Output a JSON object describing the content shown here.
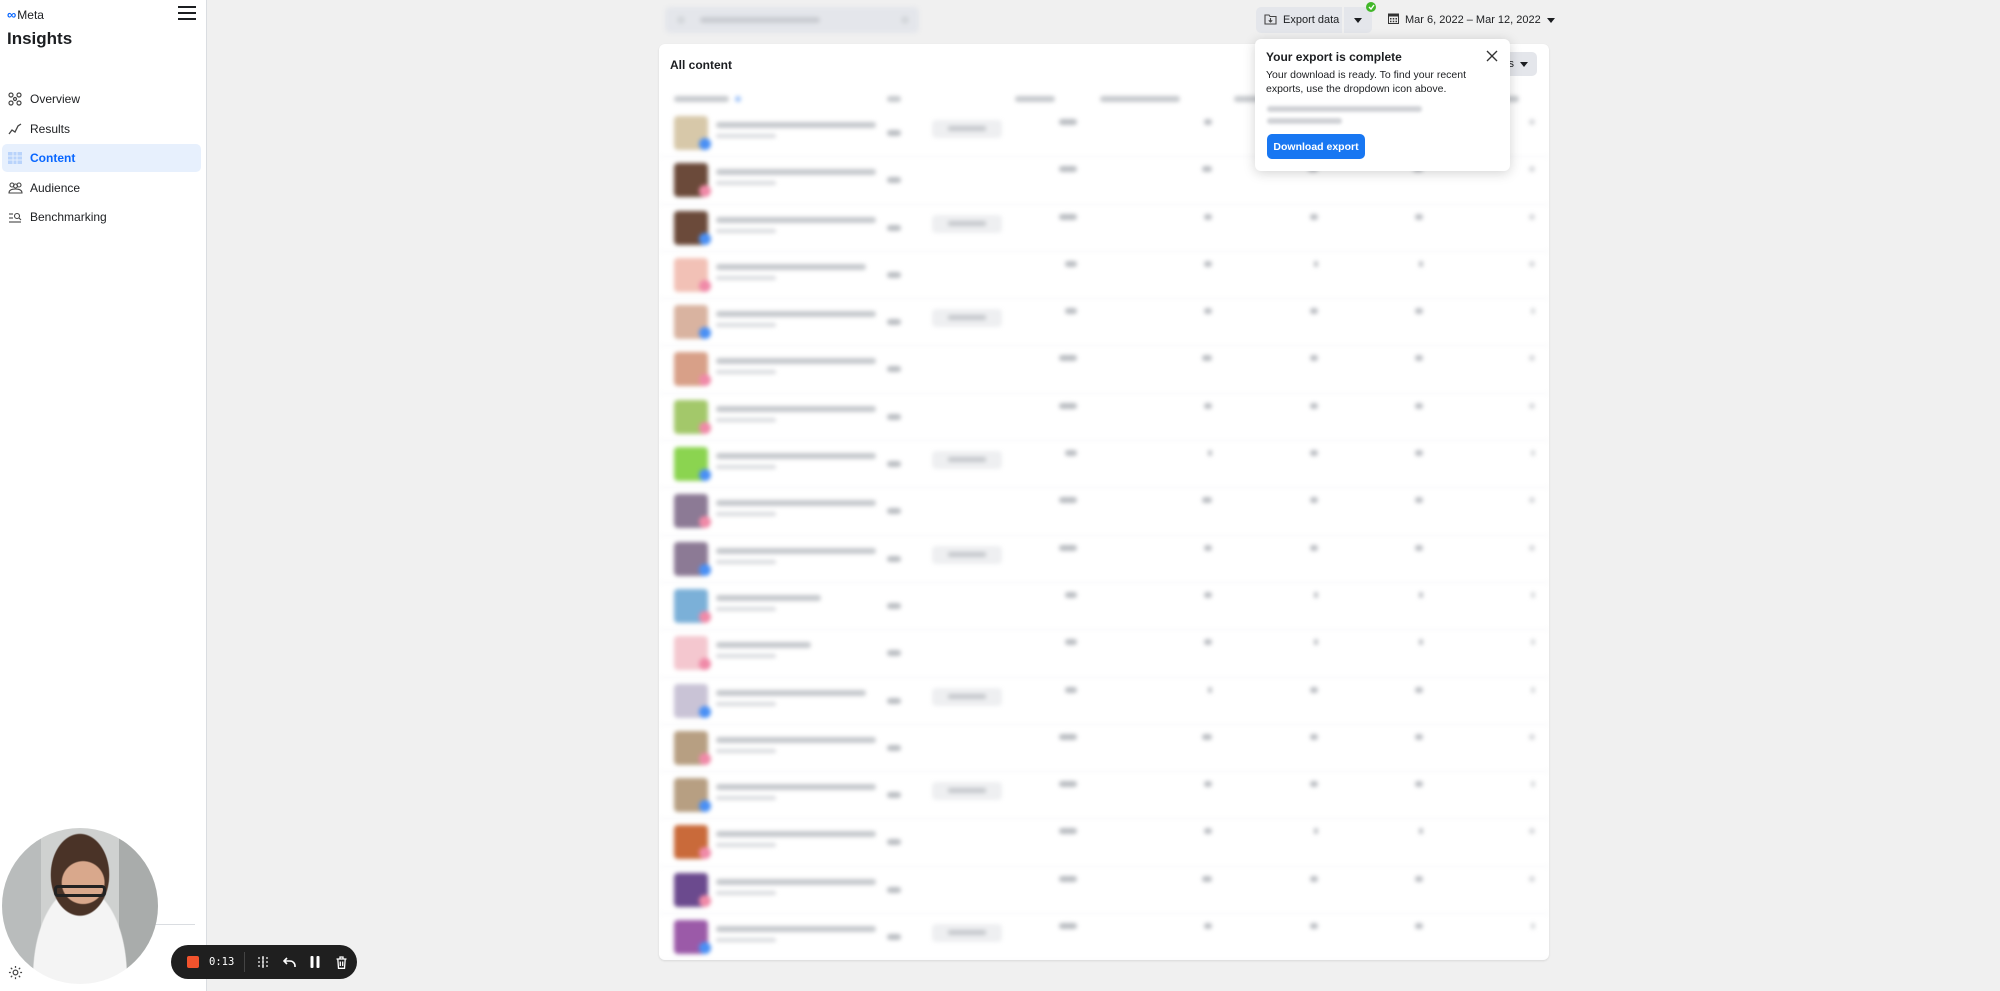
{
  "brand": {
    "logo_text": "Meta",
    "logo_icon": "meta-infinity-icon"
  },
  "app": {
    "title": "Insights",
    "menu_icon": "hamburger-icon"
  },
  "sidebar": {
    "items": [
      {
        "label": "Overview",
        "icon": "overview-network-icon",
        "active": false
      },
      {
        "label": "Results",
        "icon": "results-trend-icon",
        "active": false
      },
      {
        "label": "Content",
        "icon": "content-table-icon",
        "active": true
      },
      {
        "label": "Audience",
        "icon": "audience-people-icon",
        "active": false
      },
      {
        "label": "Benchmarking",
        "icon": "benchmarking-search-icon",
        "active": false
      }
    ],
    "footer_icons": [
      "gear-icon",
      "bell-icon",
      "help-icon",
      "panel-icon"
    ]
  },
  "toolbar": {
    "search_value": "[blurred]",
    "export_label": "Export data",
    "export_status": "complete",
    "date_range": "Mar 6, 2022 – Mar 12, 2022"
  },
  "content": {
    "title": "All content",
    "action_label": "[partially hidden]",
    "table_blurred": true,
    "row_count": 18,
    "row_badges": [
      "facebook",
      "instagram",
      "facebook",
      "instagram",
      "facebook",
      "instagram",
      "instagram",
      "facebook",
      "instagram",
      "facebook",
      "instagram",
      "instagram",
      "facebook",
      "instagram",
      "facebook",
      "instagram",
      "instagram",
      "facebook"
    ],
    "row_has_pill": [
      true,
      false,
      true,
      false,
      true,
      false,
      false,
      true,
      false,
      true,
      false,
      false,
      true,
      false,
      true,
      false,
      false,
      true
    ]
  },
  "popover": {
    "title": "Your export is complete",
    "body": "Your download is ready. To find your recent exports, use the dropdown icon above.",
    "button_label": "Download export"
  },
  "recording": {
    "elapsed": "0:13",
    "controls": [
      "stop-icon",
      "grid-icon",
      "undo-icon",
      "pause-icon",
      "trash-icon"
    ]
  },
  "colors": {
    "accent": "#0866ff",
    "button_primary": "#1877f2",
    "success": "#42b72a",
    "record": "#f2532d",
    "active_nav_bg": "#e7f0fd"
  }
}
